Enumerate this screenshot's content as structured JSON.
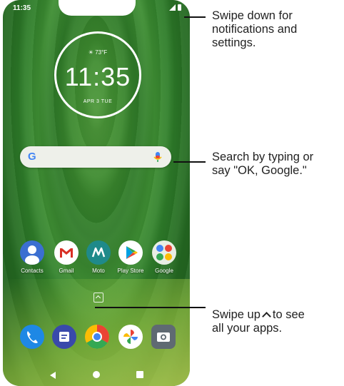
{
  "status_bar": {
    "time": "11:35"
  },
  "clock_widget": {
    "weather": "☀ 73°F",
    "time": "11:35",
    "date": "APR 3 TUE"
  },
  "search_bar": {
    "logo": "G",
    "icons": [
      "google-g-icon",
      "mic-icon"
    ]
  },
  "home_apps": [
    {
      "label": "Contacts",
      "icon": "contacts-icon"
    },
    {
      "label": "Gmail",
      "icon": "gmail-icon"
    },
    {
      "label": "Moto",
      "icon": "moto-icon"
    },
    {
      "label": "Play Store",
      "icon": "play-store-icon"
    },
    {
      "label": "Google",
      "icon": "google-folder-icon"
    }
  ],
  "dock_apps": [
    {
      "icon": "phone-icon"
    },
    {
      "icon": "messages-icon"
    },
    {
      "icon": "chrome-icon"
    },
    {
      "icon": "photos-icon"
    },
    {
      "icon": "camera-icon"
    }
  ],
  "callouts": {
    "notifications": {
      "line1": "Swipe down for",
      "line2": "notifications and",
      "line3": "settings."
    },
    "search": {
      "line1": "Search by typing or",
      "line2": "say \"OK, Google.\""
    },
    "apps": {
      "line1_before": "Swipe up",
      "line1_after": "to see",
      "line2": "all your apps."
    }
  },
  "colors": {
    "wallpaper": "#2f7a28",
    "search_bg": "#eef0ea",
    "text_dark": "#222222"
  }
}
